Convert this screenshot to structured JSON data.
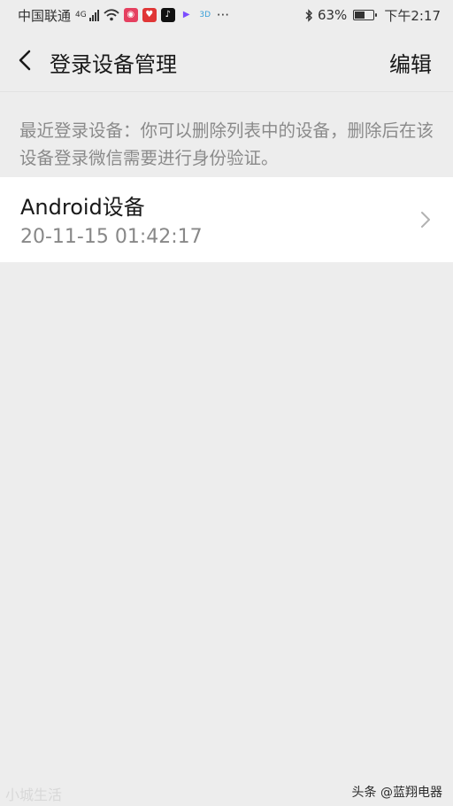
{
  "status_bar": {
    "carrier": "中国联通",
    "network": "4G",
    "battery": "63%",
    "battery_level": 0.63,
    "time": "下午2:17",
    "overflow": "···",
    "app_icons": [
      {
        "name": "red-app-icon",
        "color": "#e54060",
        "glyph": "◉"
      },
      {
        "name": "heart-app-icon",
        "color": "#e03636",
        "glyph": "♥"
      },
      {
        "name": "tiktok-icon",
        "color": "#111111",
        "glyph": "♪"
      },
      {
        "name": "play-icon",
        "color": "#7b4cff",
        "glyph": "▶"
      },
      {
        "name": "3d-app-icon",
        "color": "#3aa0d8",
        "glyph": "3D"
      }
    ]
  },
  "header": {
    "title": "登录设备管理",
    "edit_label": "编辑"
  },
  "description": "最近登录设备：你可以删除列表中的设备，删除后在该设备登录微信需要进行身份验证。",
  "devices": [
    {
      "name": "Android设备",
      "time": "20-11-15 01:42:17"
    }
  ],
  "watermarks": {
    "left": "小城生活",
    "right": "头条 @蓝翔电器"
  },
  "colors": {
    "background": "#ededed",
    "card": "#ffffff",
    "primary_text": "#191919",
    "secondary_text": "#8a8a8a"
  }
}
